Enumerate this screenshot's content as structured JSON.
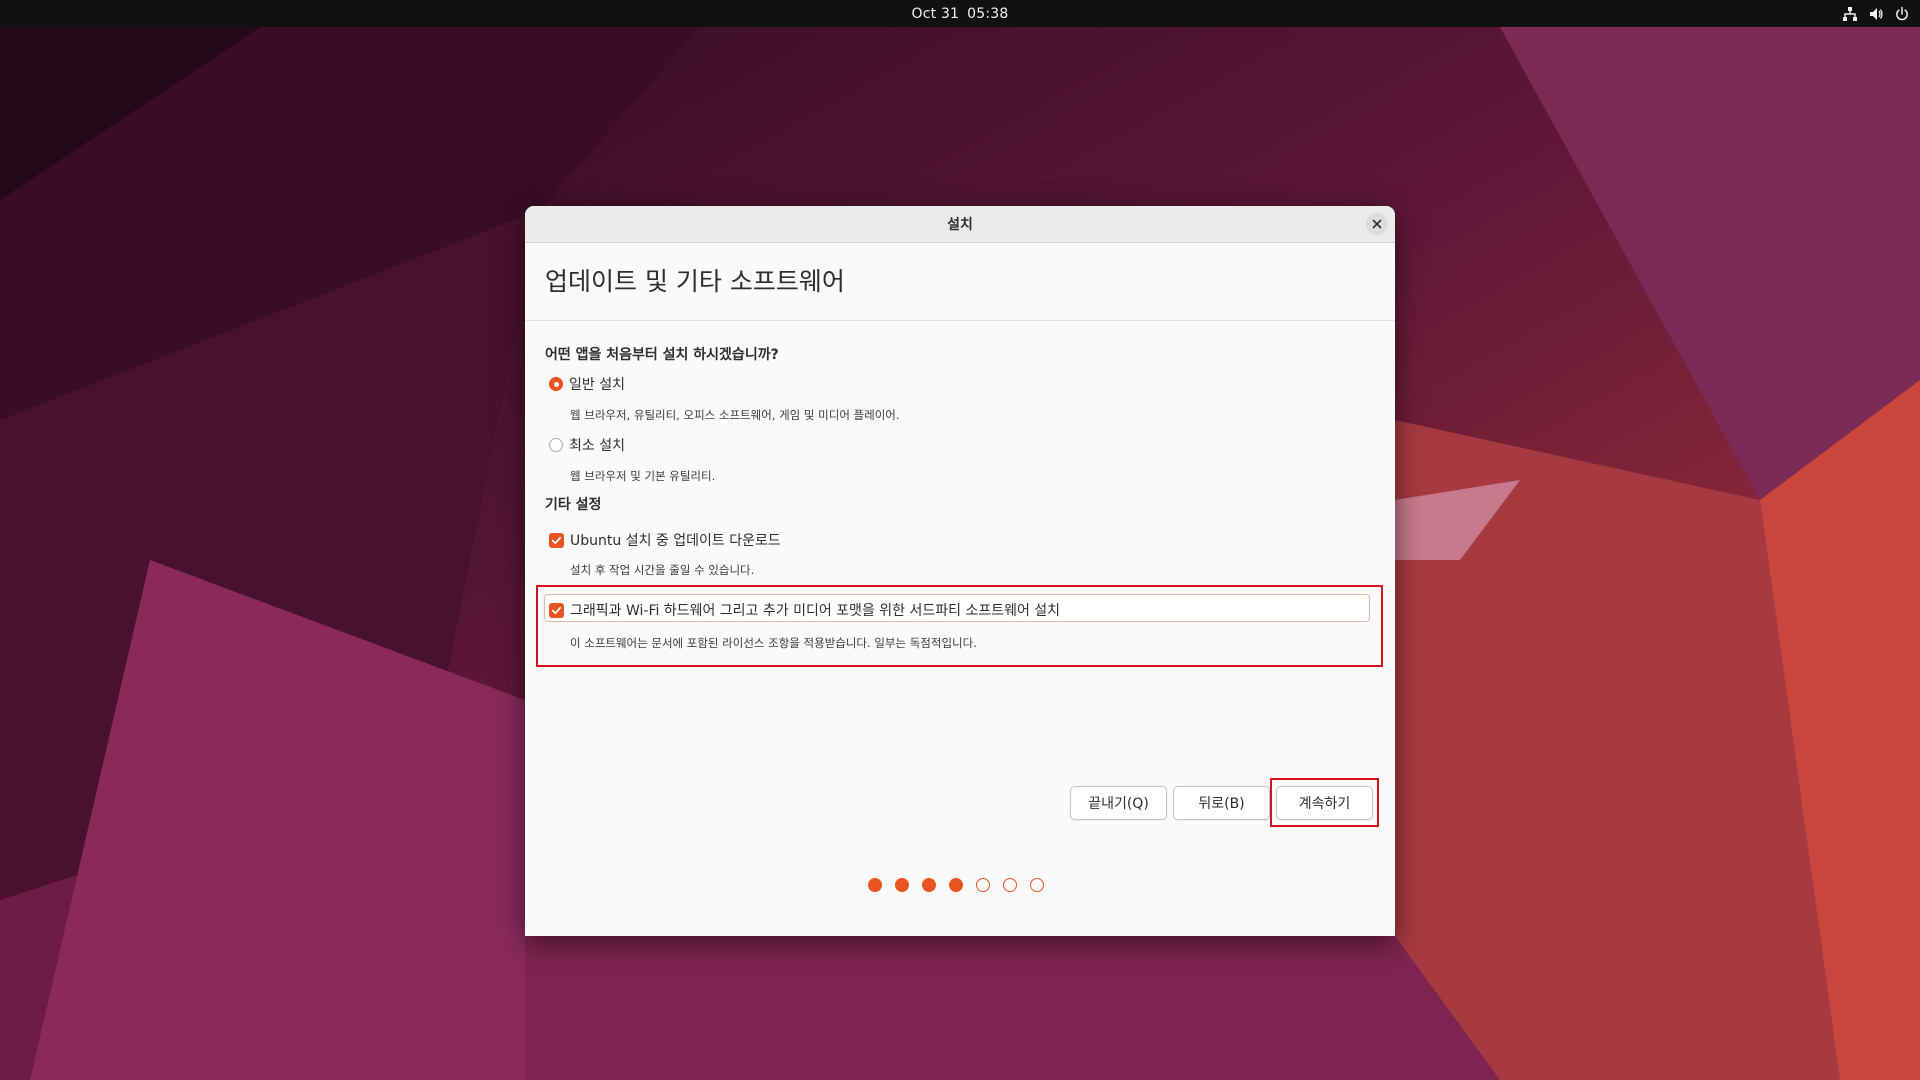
{
  "topbar": {
    "date": "Oct 31",
    "time": "05:38",
    "icons": [
      "network-icon",
      "volume-icon",
      "power-icon"
    ]
  },
  "dialog": {
    "title": "설치",
    "heading": "업데이트 및 기타 소프트웨어",
    "install_question": "어떤 앱을 처음부터 설치 하시겠습니까?",
    "options": [
      {
        "label": "일반 설치",
        "description": "웹 브라우저, 유틸리티, 오피스 소프트웨어, 게임 및 미디어 플레이어.",
        "selected": true
      },
      {
        "label": "최소 설치",
        "description": "웹 브라우저 및 기본 유틸리티.",
        "selected": false
      }
    ],
    "other_settings_label": "기타 설정",
    "checkboxes": [
      {
        "label": "Ubuntu 설치 중 업데이트 다운로드",
        "description": "설치 후 작업 시간을 줄일 수 있습니다.",
        "checked": true
      },
      {
        "label": "그래픽과 Wi-Fi 하드웨어 그리고 추가 미디어 포맷을 위한 서드파티 소프트웨어 설치",
        "description": "이 소프트웨어는 문서에 포함된 라이선스 조항을 적용받습니다. 일부는 독점적입니다.",
        "checked": true
      }
    ],
    "buttons": {
      "quit": "끝내기(Q)",
      "back": "뒤로(B)",
      "continue": "계속하기"
    },
    "progress": {
      "current_step": 4,
      "total_steps": 7
    }
  },
  "colors": {
    "accent": "#e95420",
    "highlight": "#d8121b",
    "topbar": "#111111"
  }
}
